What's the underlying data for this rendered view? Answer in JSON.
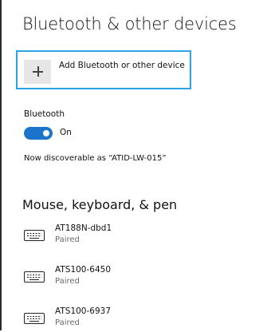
{
  "header": {
    "title": "Bluetooth & other devices"
  },
  "add_device": {
    "label": "Add Bluetooth or other device",
    "icon": "plus-icon"
  },
  "bluetooth": {
    "label": "Bluetooth",
    "toggle_state": "On",
    "toggle_on": true,
    "accent": "#1b74c9"
  },
  "discoverable_text": "Now discoverable as “ATID-LW-015”",
  "section": {
    "title": "Mouse, keyboard, & pen",
    "devices": [
      {
        "name": "AT188N-dbd1",
        "status": "Paired",
        "icon": "keyboard-icon"
      },
      {
        "name": "ATS100-6450",
        "status": "Paired",
        "icon": "keyboard-icon"
      },
      {
        "name": "ATS100-6937",
        "status": "Paired",
        "icon": "keyboard-icon"
      }
    ]
  }
}
